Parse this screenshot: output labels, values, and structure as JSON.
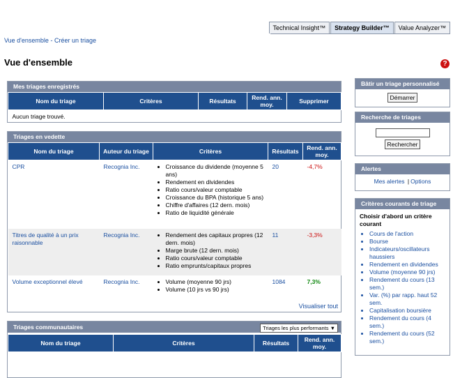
{
  "tabs": [
    {
      "label": "Technical Insight™",
      "active": false
    },
    {
      "label": "Strategy Builder™",
      "active": true
    },
    {
      "label": "Value Analyzer™",
      "active": false
    }
  ],
  "breadcrumb": {
    "home": "Vue d'ensemble",
    "sep": " - ",
    "current": "Créer un triage"
  },
  "page_title": "Vue d'ensemble",
  "help_glyph": "?",
  "saved": {
    "title": "Mes triages enregistrés",
    "columns": [
      "Nom du triage",
      "Critères",
      "Résultats",
      "Rend. ann. moy.",
      "Supprimer"
    ],
    "empty": "Aucun triage trouvé."
  },
  "featured": {
    "title": "Triages en vedette",
    "columns": [
      "Nom du triage",
      "Auteur du triage",
      "Critères",
      "Résultats",
      "Rend. ann. moy."
    ],
    "rows": [
      {
        "name": "CPR",
        "author": "Recognia Inc.",
        "criteria": [
          "Croissance du dividende (moyenne 5 ans)",
          "Rendement en dividendes",
          "Ratio cours/valeur comptable",
          "Croissance du BPA (historique 5 ans)",
          "Chiffre d'affaires (12 dern. mois)",
          "Ratio de liquidité générale"
        ],
        "results": "20",
        "return": "-4,7%"
      },
      {
        "name": "Titres de qualité à un prix raisonnable",
        "author": "Recognia Inc.",
        "criteria": [
          "Rendement des capitaux propres (12 dern. mois)",
          "Marge brute (12 dern. mois)",
          "Ratio cours/valeur comptable",
          "Ratio emprunts/capitaux propres"
        ],
        "results": "11",
        "return": "-3,3%"
      },
      {
        "name": "Volume exceptionnel élevé",
        "author": "Recognia Inc.",
        "criteria": [
          "Volume (moyenne 90 jrs)",
          "Volume (10 jrs vs 90 jrs)"
        ],
        "results": "1084",
        "return": "7,3%"
      }
    ],
    "view_all": "Visualiser tout"
  },
  "community": {
    "title": "Triages communautaires",
    "dropdown": "Triages les plus performants",
    "columns": [
      "Nom du triage",
      "Critères",
      "Résultats",
      "Rend. ann. moy."
    ]
  },
  "sidebar": {
    "build": {
      "title": "Bâtir un triage personnalisé",
      "button": "Démarrer"
    },
    "search": {
      "title": "Recherche de triages",
      "value": "",
      "button": "Rechercher"
    },
    "alerts": {
      "title": "Alertes",
      "my_alerts": "Mes alertes",
      "sep": "|",
      "options": "Options"
    },
    "criteria": {
      "title": "Critères courants de triage",
      "intro": "Choisir d'abord un critère courant",
      "items": [
        "Cours de l'action",
        "Bourse",
        "Indicateurs/oscillateurs haussiers",
        "Rendement en dividendes",
        "Volume (moyenne 90 jrs)",
        "Rendement du cours (13 sem.)",
        "Var. (%) par rapp. haut 52 sem.",
        "Capitalisation boursière",
        "Rendement du cours (4 sem.)",
        "Rendement du cours (52 sem.)"
      ]
    }
  },
  "colors": {
    "header_blue": "#1f4f8e",
    "panel_header": "#7886a0",
    "link": "#1a4fa0",
    "negative": "#cc1111",
    "positive": "#118811"
  }
}
